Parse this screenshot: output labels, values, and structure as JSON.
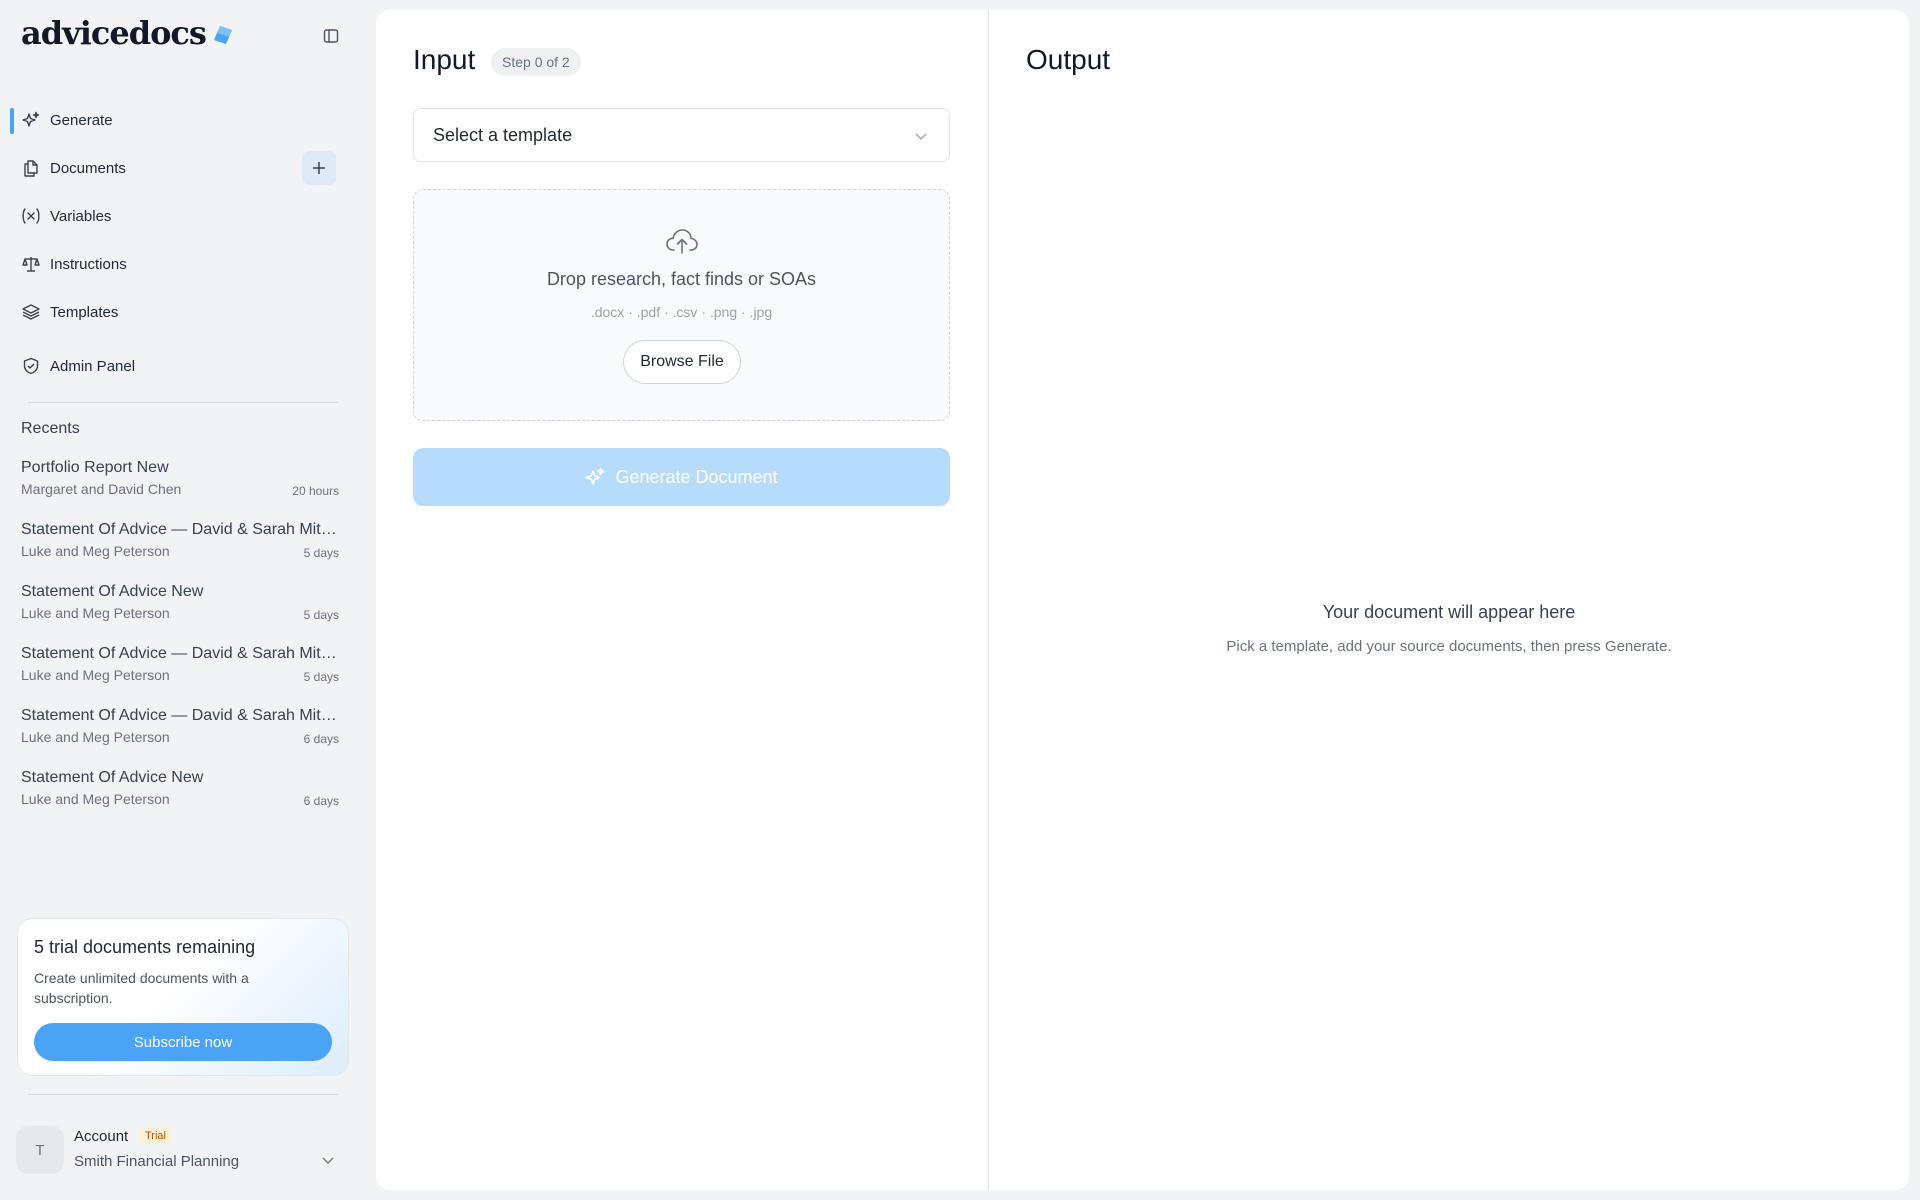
{
  "app": {
    "logo_text": "advicedocs"
  },
  "colors": {
    "accent": "#4aa3f5",
    "generate_disabled": "#b7dcfb"
  },
  "nav": [
    {
      "label": "Generate",
      "icon": "sparkle-icon",
      "active": true
    },
    {
      "label": "Documents",
      "icon": "documents-icon"
    },
    {
      "label": "Variables",
      "icon": "variable-icon"
    },
    {
      "label": "Instructions",
      "icon": "scale-icon"
    },
    {
      "label": "Templates",
      "icon": "layers-icon"
    },
    {
      "label": "Admin Panel",
      "icon": "shield-icon"
    }
  ],
  "recents": {
    "title": "Recents",
    "items": [
      {
        "title": "Portfolio Report New",
        "subtitle": "Margaret and David Chen",
        "time": "20 hours"
      },
      {
        "title": "Statement Of Advice — David & Sarah Mitchell",
        "subtitle": "Luke and Meg Peterson",
        "time": "5 days"
      },
      {
        "title": "Statement Of Advice New",
        "subtitle": "Luke and Meg Peterson",
        "time": "5 days"
      },
      {
        "title": "Statement Of Advice — David & Sarah Mitchell",
        "subtitle": "Luke and Meg Peterson",
        "time": "5 days"
      },
      {
        "title": "Statement Of Advice — David & Sarah Mitchell",
        "subtitle": "Luke and Meg Peterson",
        "time": "6 days"
      },
      {
        "title": "Statement Of Advice New",
        "subtitle": "Luke and Meg Peterson",
        "time": "6 days"
      }
    ]
  },
  "trial": {
    "title": "5 trial documents remaining",
    "description": "Create unlimited documents with a subscription.",
    "button": "Subscribe now"
  },
  "account": {
    "avatar_initial": "T",
    "label": "Account",
    "badge": "Trial",
    "org": "Smith Financial Planning"
  },
  "input": {
    "title": "Input",
    "step": "Step 0 of 2",
    "template_placeholder": "Select a template",
    "dropzone_text": "Drop research, fact finds or SOAs",
    "formats": ".docx · .pdf · .csv · .png · .jpg",
    "browse_label": "Browse File",
    "generate_label": "Generate Document"
  },
  "output": {
    "title": "Output",
    "empty_title": "Your document will appear here",
    "empty_subtitle": "Pick a template, add your source documents, then press Generate."
  }
}
